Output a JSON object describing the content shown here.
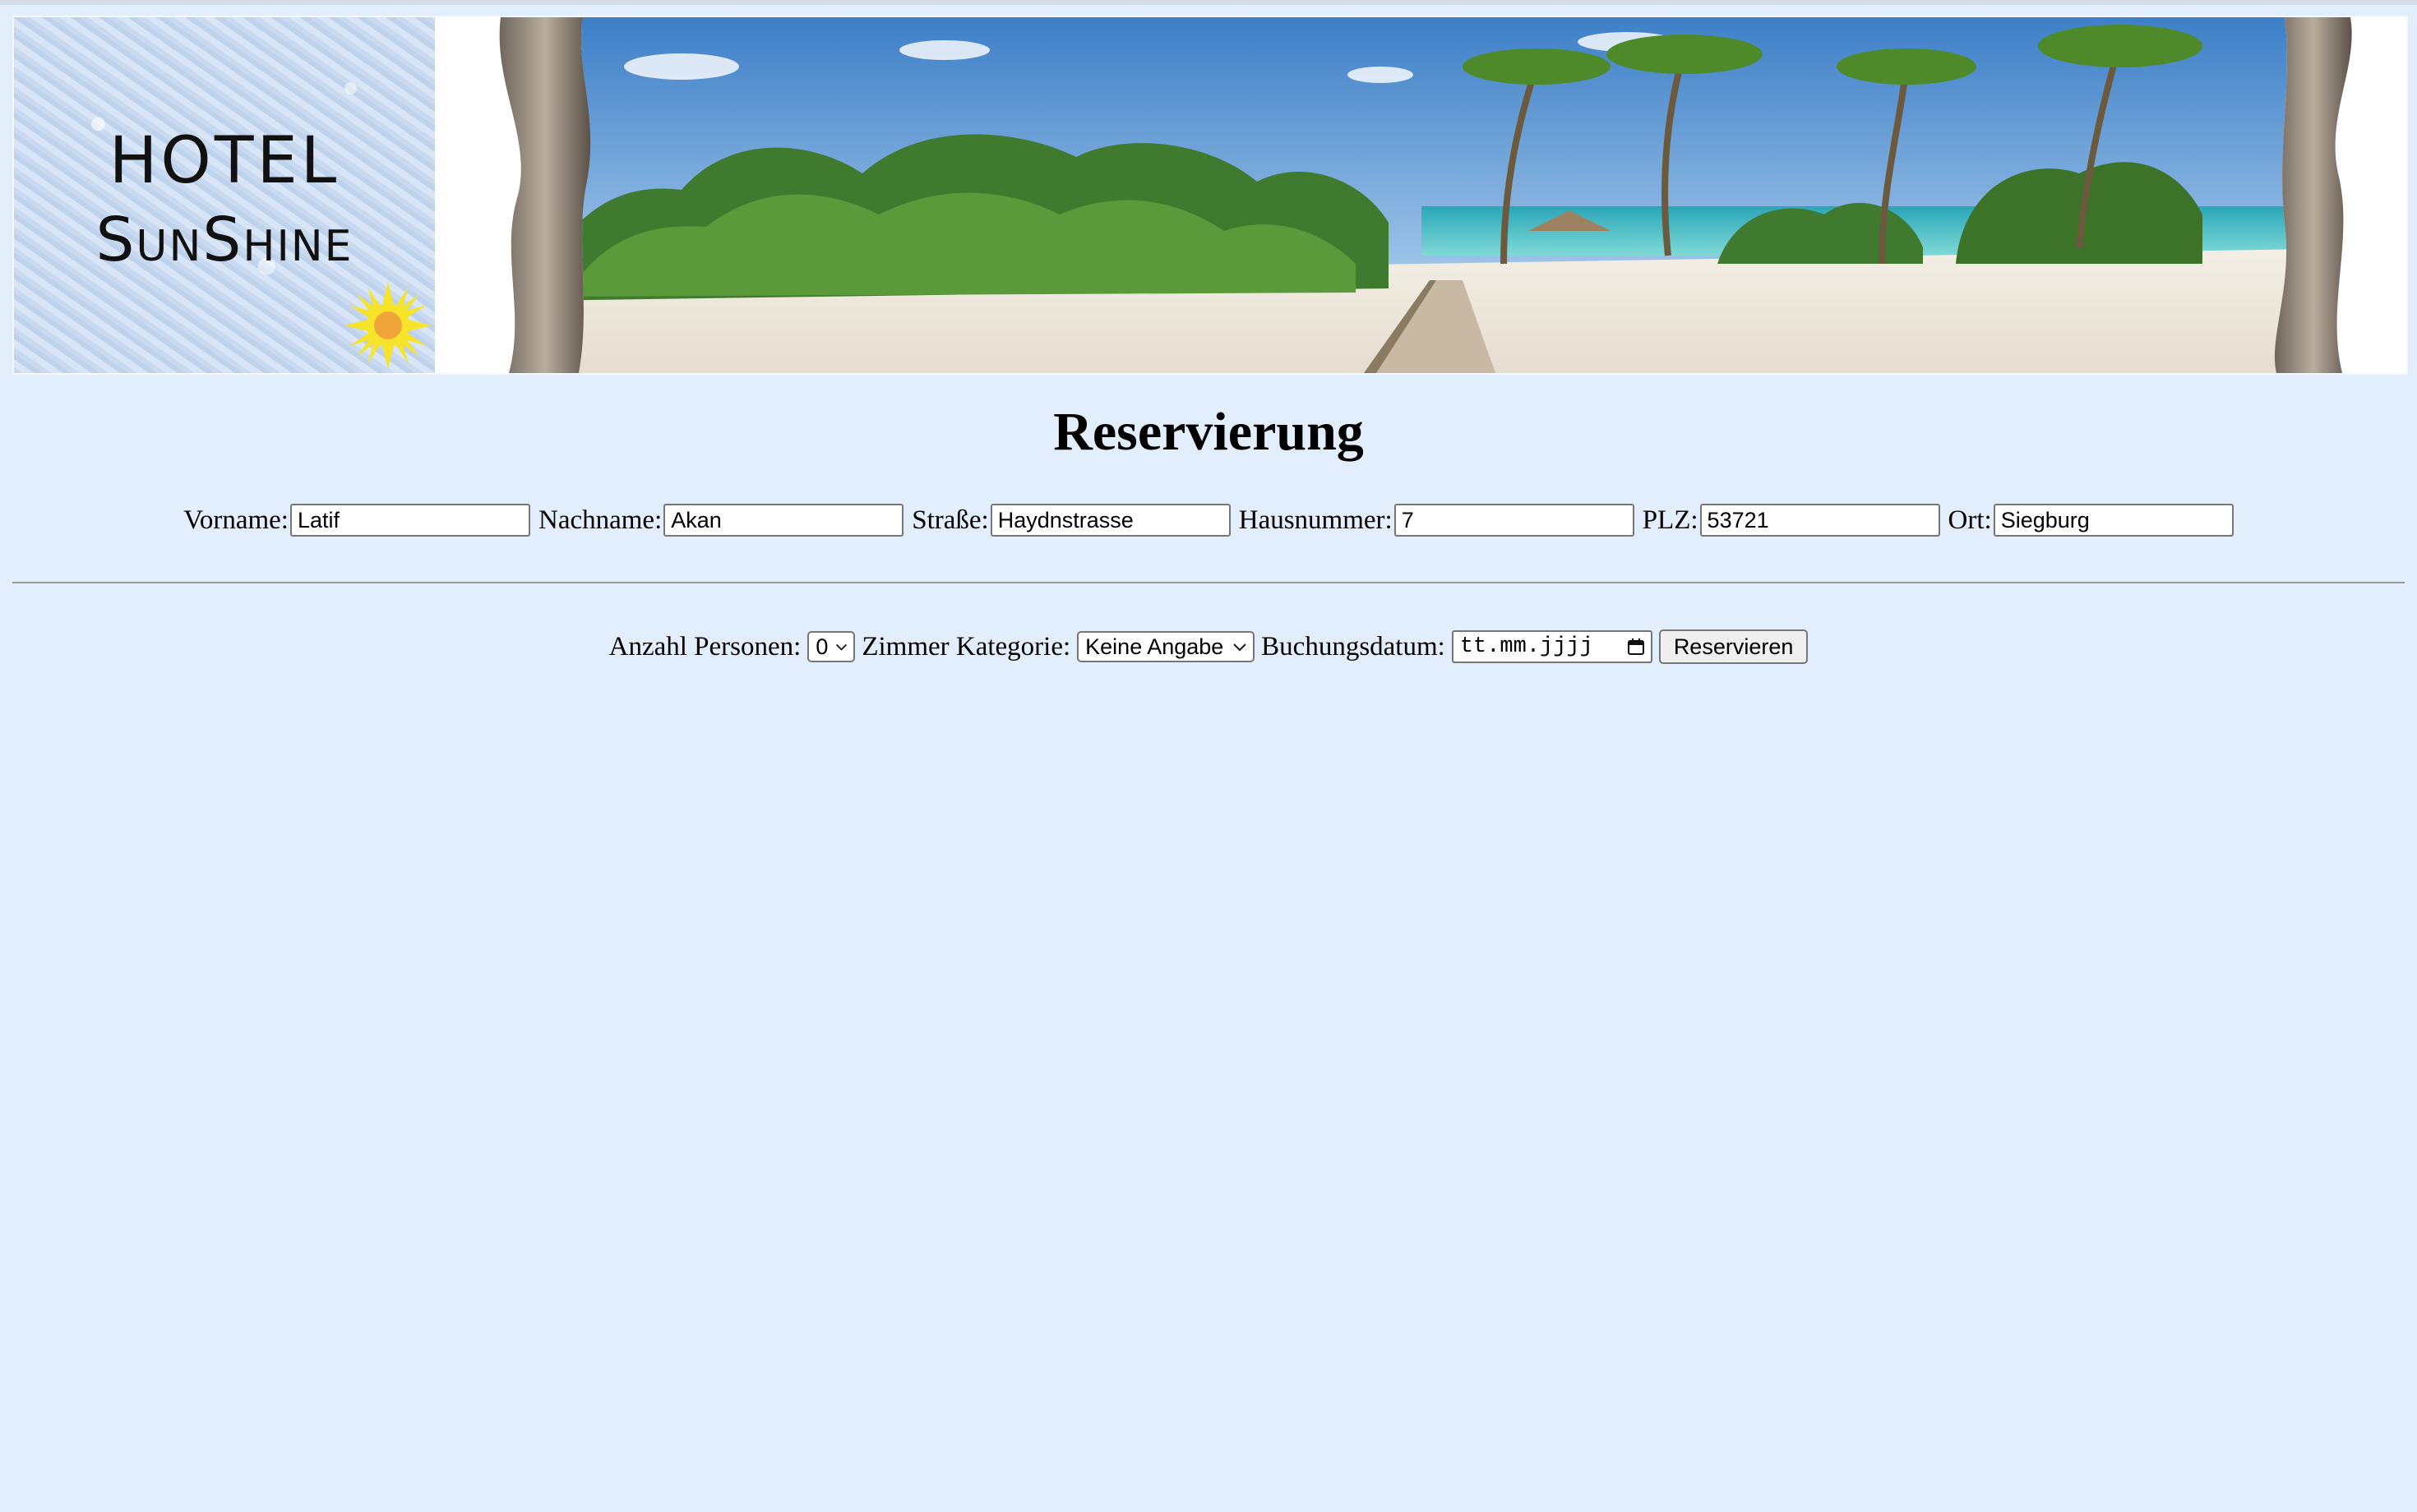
{
  "header": {
    "logo_line1": "HOTEL",
    "logo_line2": "SunShine",
    "sun_color": "#f5e42a",
    "sun_core_color": "#f0a53a"
  },
  "page": {
    "title": "Reservierung",
    "background": "#e2eefb"
  },
  "personal": {
    "vorname_label": "Vorname:",
    "vorname_value": "Latif",
    "nachname_label": "Nachname:",
    "nachname_value": "Akan",
    "strasse_label": "Straße:",
    "strasse_value": "Haydnstrasse",
    "hausnummer_label": "Hausnummer:",
    "hausnummer_value": "7",
    "plz_label": "PLZ:",
    "plz_value": "53721",
    "ort_label": "Ort:",
    "ort_value": "Siegburg"
  },
  "booking": {
    "persons_label": "Anzahl Personen:",
    "persons_value": "0",
    "category_label": "Zimmer Kategorie:",
    "category_value": "Keine Angabe",
    "date_label": "Buchungsdatum:",
    "date_placeholder": "tt.mm.jjjj",
    "submit_label": "Reservieren"
  }
}
